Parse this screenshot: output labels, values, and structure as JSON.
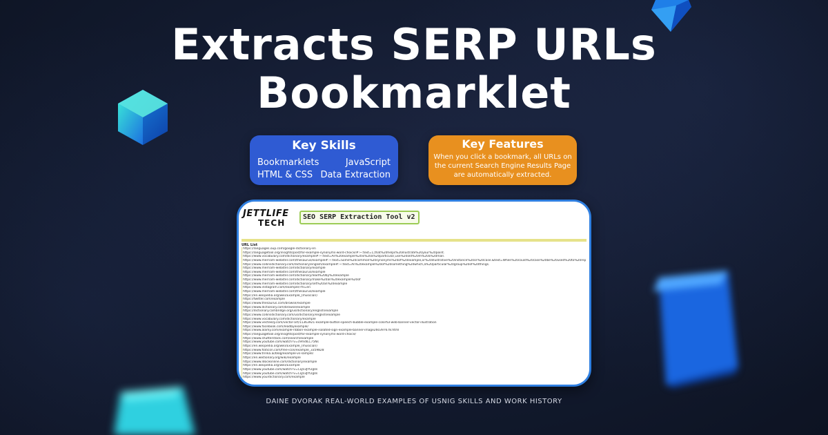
{
  "title": {
    "line1": "Extracts SERP URLs",
    "line2": "Bookmarklet"
  },
  "key_skills": {
    "heading": "Key Skills",
    "items": [
      "Bookmarklets",
      "JavaScript",
      "HTML & CSS",
      "Data Extraction"
    ]
  },
  "key_features": {
    "heading": "Key Features",
    "description": "When you click a bookmark, all URLs on the current Search Engine Results Page are automatically extracted."
  },
  "screenshot": {
    "logo_line1": "JETTLIFE",
    "logo_line2": "TECH",
    "tool_title": "SEO SERP Extraction Tool v2",
    "list_header": "URL List",
    "urls": [
      "https://languages.oup.com/google-dictionary-en",
      "https://languagetool.org/insights/post/for-example-synonyms-word-choice/#:~:text=1,that%20helps%20illustrate%20your%20point.",
      "https://www.vocabulary.com/dictionary/example#:~:text=An%20example%20is%20a%20particular,use%20old%20m%20a%20mall.",
      "https://www.merriam-webster.com/thesaurus/example#:~:text=Some%20common%20synonyms%20of%20example,or%20illustrative%20instance%20or%20case.&text=When%20could%20case%20be%20used%20to%20replace",
      "https://www.collinsdictionary.com/dictionary/english/example#:~:text=An%20example%20of%20something%20which,a%20particular%20group%20of%20things.",
      "https://www.merriam-webster.com/dictionary/example",
      "https://www.merriam-webster.com/thesaurus/example",
      "https://www.merriam-webster.com/dictionary/lead%20by%20example",
      "https://www.merriam-webster.com/dictionary/make%20an%20example%20of",
      "https://www.merriam-webster.com/dictionary/set%20an%20example",
      "https://www.instagram.com/example/?hl=en",
      "https://www.merriam-webster.com/thesaurus/example",
      "https://en.wikipedia.org/wiki/Example_(musician)",
      "https://twitter.com/example",
      "https://www.thesaurus.com/browse/example",
      "https://www.dictionary.com/browse/example",
      "https://dictionary.cambridge.org/us/dictionary/english/example",
      "https://www.collinsdictionary.com/us/dictionary/english/example",
      "https://www.vocabulary.com/dictionary/example",
      "https://www.vecteezy.com/vector-art/11363921-example-button-speech-bubble-example-colorful-web-banner-vector-illustration",
      "https://www.facebook.com/leadbyexample/",
      "https://www.alamy.com/example-ribbon-example-isolated-sign-example-banner-image260397678.html",
      "https://languagetool.org/insights/post/for-example-synonyms-word-choice/",
      "https://www.shutterstock.com/search/example",
      "https://www.youtube.com/watch?v=c9mdlLC75Ns",
      "https://en.wikipedia.org/wiki/Example_(musician)",
      "https://www.flaticon.com/free-icon/example_3359828",
      "https://www.trinka.ai/blog/example-vs-sample/",
      "https://en.wiktionary.org/wiki/example",
      "https://www.ldoceonline.com/dictionary/example",
      "https://en.wikipedia.org/wiki/Example",
      "https://www.youtube.com/watch?v=CLJ03JYf2g0s",
      "https://www.youtube.com/watch?v=CLJ03JYf2g0s",
      "https://www.yourdictionary.com/example"
    ]
  },
  "footer": "DAINE DVORAK REAL-WORLD EXAMPLES OF USNIG SKILLS AND WORK HISTORY",
  "colors": {
    "background": "#141c30",
    "skills_card": "#2f5bd3",
    "features_card": "#e8901f",
    "screenshot_border": "#2f7fe0",
    "tool_title_border": "#9ccc55"
  }
}
